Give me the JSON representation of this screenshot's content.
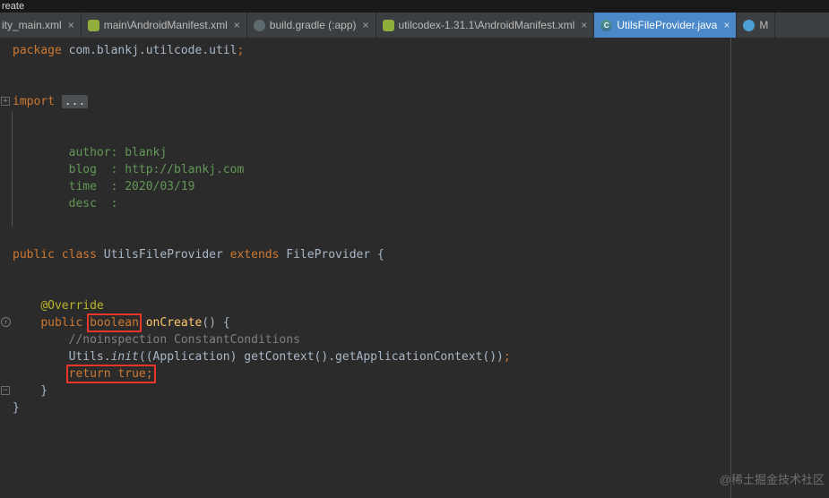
{
  "titlebar": {
    "text": "reate"
  },
  "tabbar": {
    "tabs": [
      {
        "label": "ity_main.xml",
        "icon": "none",
        "close": "×",
        "active": false
      },
      {
        "label": "main\\AndroidManifest.xml",
        "icon": "android",
        "close": "×",
        "active": false
      },
      {
        "label": "build.gradle (:app)",
        "icon": "gradle",
        "close": "×",
        "active": false
      },
      {
        "label": "utilcodex-1.31.1\\AndroidManifest.xml",
        "icon": "android",
        "close": "×",
        "active": false
      },
      {
        "label": "UtilsFileProvider.java",
        "icon": "class",
        "close": "×",
        "active": true
      },
      {
        "label": "M",
        "icon": "bluefile",
        "close": "",
        "active": false
      }
    ]
  },
  "editor": {
    "file": "UtilsFileProvider.java",
    "lines": [
      {
        "segs": [
          {
            "t": "package ",
            "c": "kw"
          },
          {
            "t": "com.blankj.utilcode.util",
            "c": "plain"
          },
          {
            "t": ";",
            "c": "kw"
          }
        ]
      },
      {
        "segs": []
      },
      {
        "segs": []
      },
      {
        "gutter": "fold-plus",
        "segs": [
          {
            "t": "import ",
            "c": "kw"
          },
          {
            "t": "...",
            "c": "fold"
          }
        ]
      },
      {
        "segs": []
      },
      {
        "segs": []
      },
      {
        "segs": [
          {
            "t": "        author: blankj",
            "c": "doc"
          }
        ]
      },
      {
        "segs": [
          {
            "t": "        blog  : http://blankj.com",
            "c": "doc"
          }
        ]
      },
      {
        "segs": [
          {
            "t": "        time  : 2020/03/19",
            "c": "doc"
          }
        ]
      },
      {
        "segs": [
          {
            "t": "        desc  :",
            "c": "doc"
          }
        ]
      },
      {
        "segs": []
      },
      {
        "segs": []
      },
      {
        "segs": [
          {
            "t": "public class ",
            "c": "kw"
          },
          {
            "t": "UtilsFileProvider ",
            "c": "plain"
          },
          {
            "t": "extends ",
            "c": "kw"
          },
          {
            "t": "FileProvider {",
            "c": "plain"
          }
        ]
      },
      {
        "segs": []
      },
      {
        "segs": []
      },
      {
        "segs": [
          {
            "t": "    ",
            "c": "plain"
          },
          {
            "t": "@Override",
            "c": "ann"
          }
        ]
      },
      {
        "gutter": "override",
        "segs": [
          {
            "t": "    ",
            "c": "plain"
          },
          {
            "t": "public ",
            "c": "kw"
          },
          {
            "t": "boolean",
            "c": "kw",
            "box": true
          },
          {
            "t": " ",
            "c": "plain"
          },
          {
            "t": "onCreate",
            "c": "method"
          },
          {
            "t": "() {",
            "c": "plain"
          }
        ]
      },
      {
        "segs": [
          {
            "t": "        ",
            "c": "plain"
          },
          {
            "t": "//noinspection ConstantConditions",
            "c": "comment"
          }
        ]
      },
      {
        "segs": [
          {
            "t": "        Utils.",
            "c": "plain"
          },
          {
            "t": "init",
            "c": "plain-italic"
          },
          {
            "t": "((Application) getContext().getApplicationContext())",
            "c": "plain"
          },
          {
            "t": ";",
            "c": "kw"
          }
        ]
      },
      {
        "segs": [
          {
            "t": "        ",
            "c": "plain"
          },
          {
            "t": "return true;",
            "c": "kw",
            "box": true
          }
        ]
      },
      {
        "gutter": "fold-end",
        "segs": [
          {
            "t": "    }",
            "c": "plain"
          }
        ]
      },
      {
        "segs": [
          {
            "t": "}",
            "c": "plain"
          }
        ]
      }
    ]
  },
  "watermark": {
    "text": "@稀土掘金技术社区"
  },
  "colors": {
    "editor_bg": "#2b2b2b",
    "titlebar_bg": "#191919",
    "tabbar_bg": "#3c3f41",
    "tab_active_bg": "#4a88c7",
    "tab_text": "#bbbbbb",
    "tab_active_text": "#ffffff",
    "keyword": "#cc7832",
    "plain": "#a9b7c6",
    "comment": "#808080",
    "doc_comment": "#629755",
    "method": "#ffc66b",
    "annotation": "#bbb529",
    "fold_bg": "#4c5052",
    "fold_text": "#cfcfcf",
    "red_box": "#e8362c",
    "guide_line": "#4a4a4a",
    "gutter_icon": "#8a8a8a",
    "watermark": "#6f6f6f"
  }
}
